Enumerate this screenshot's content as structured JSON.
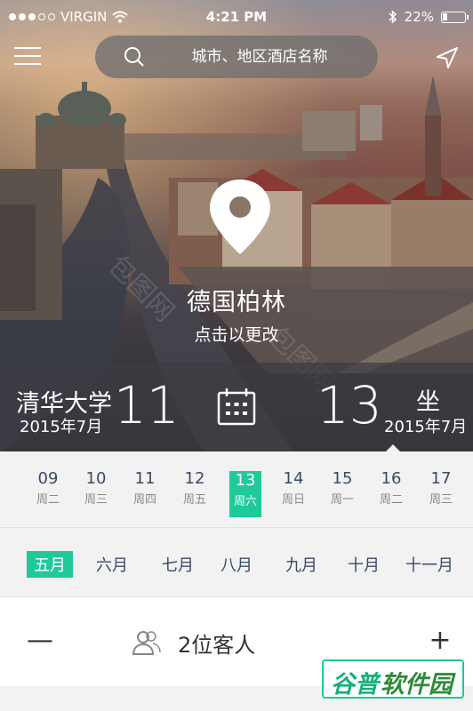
{
  "status_bar": {
    "carrier": "VIRGIN",
    "time": "4:21 PM",
    "battery": "22%"
  },
  "search": {
    "placeholder": "城市、地区酒店名称"
  },
  "location": {
    "city": "德国柏林",
    "hint": "点击以更改"
  },
  "checkin": {
    "label": "清华大学",
    "month": "2015年7月",
    "day": "11"
  },
  "checkout": {
    "label": "坐",
    "month": "2015年7月",
    "day": "13"
  },
  "days": [
    {
      "num": "09",
      "weekday": "周二"
    },
    {
      "num": "10",
      "weekday": "周三"
    },
    {
      "num": "11",
      "weekday": "周四"
    },
    {
      "num": "12",
      "weekday": "周五"
    },
    {
      "num": "13",
      "weekday": "周六",
      "selected": true
    },
    {
      "num": "14",
      "weekday": "周日"
    },
    {
      "num": "15",
      "weekday": "周一"
    },
    {
      "num": "16",
      "weekday": "周二"
    },
    {
      "num": "17",
      "weekday": "周三"
    }
  ],
  "months": [
    {
      "label": "五月",
      "selected": true
    },
    {
      "label": "六月"
    },
    {
      "label": "七月"
    },
    {
      "label": "八月"
    },
    {
      "label": "九月"
    },
    {
      "label": "十月"
    },
    {
      "label": "十一月"
    }
  ],
  "guests": {
    "label": "2位客人",
    "minus": "—",
    "plus": "+"
  },
  "watermark": {
    "part1": "谷普",
    "part2": "软件园"
  },
  "colors": {
    "accent": "#1fc99a",
    "text": "#3a4a66"
  },
  "icons": [
    "menu-icon",
    "search-icon",
    "location-arrow-icon",
    "map-pin-icon",
    "calendar-icon",
    "guests-icon",
    "wifi-icon",
    "bluetooth-icon",
    "battery-icon"
  ]
}
